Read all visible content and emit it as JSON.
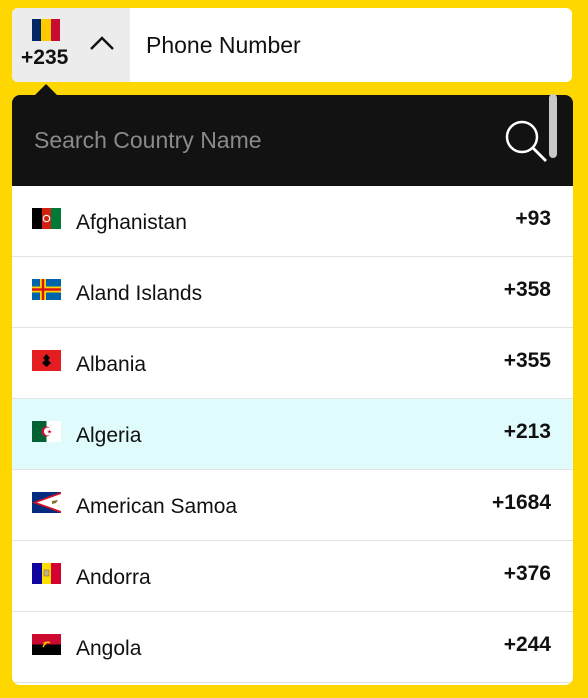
{
  "selected_country": {
    "code": "+235",
    "flag_colors": [
      "#002664",
      "#FECB00",
      "#C60C30"
    ],
    "flag": "chad-flag-icon"
  },
  "phone_label": "Phone Number",
  "search": {
    "placeholder": "Search Country Name",
    "icon": "search-icon"
  },
  "dropdown_bg": "#121212",
  "highlight_color": "#E0FBFB",
  "countries": [
    {
      "name": "Afghanistan",
      "code": "+93",
      "flag": "afghanistan-flag-icon"
    },
    {
      "name": "Aland Islands",
      "code": "+358",
      "flag": "aland-islands-flag-icon"
    },
    {
      "name": "Albania",
      "code": "+355",
      "flag": "albania-flag-icon"
    },
    {
      "name": "Algeria",
      "code": "+213",
      "flag": "algeria-flag-icon",
      "highlighted": true
    },
    {
      "name": "American Samoa",
      "code": "+1684",
      "flag": "american-samoa-flag-icon"
    },
    {
      "name": "Andorra",
      "code": "+376",
      "flag": "andorra-flag-icon"
    },
    {
      "name": "Angola",
      "code": "+244",
      "flag": "angola-flag-icon"
    }
  ]
}
